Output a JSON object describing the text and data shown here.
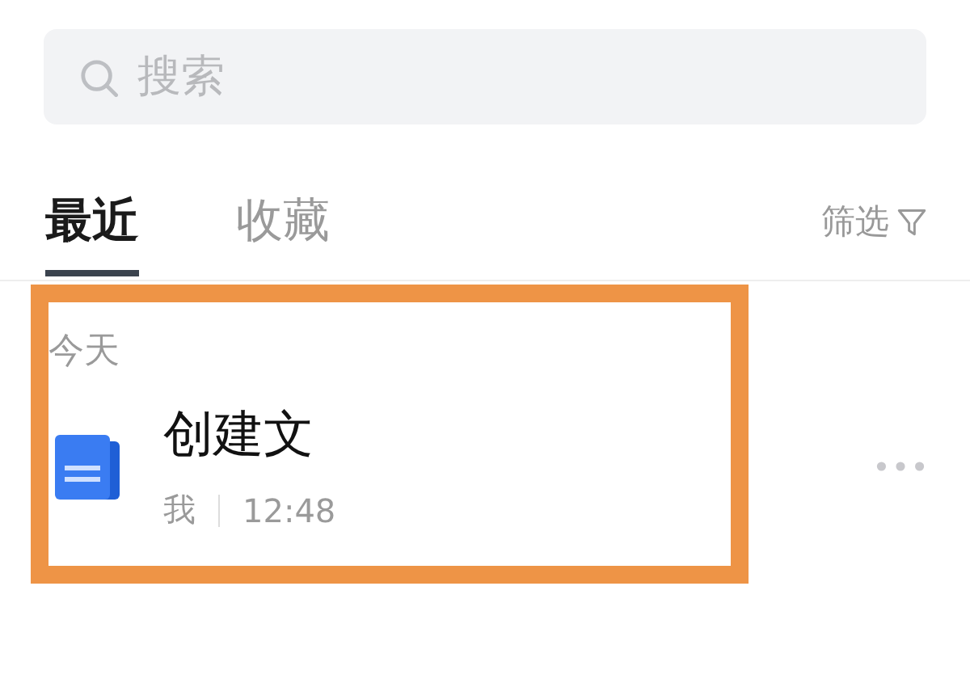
{
  "search": {
    "placeholder": "搜索"
  },
  "tabs": [
    {
      "label": "最近",
      "selected": true
    },
    {
      "label": "收藏",
      "selected": false
    }
  ],
  "filter": {
    "label": "筛选"
  },
  "groups": [
    {
      "title": "今天",
      "files": [
        {
          "name": "创建文",
          "owner": "我",
          "time": "12:48"
        }
      ]
    }
  ],
  "highlight": {
    "color": "#ee9446"
  }
}
